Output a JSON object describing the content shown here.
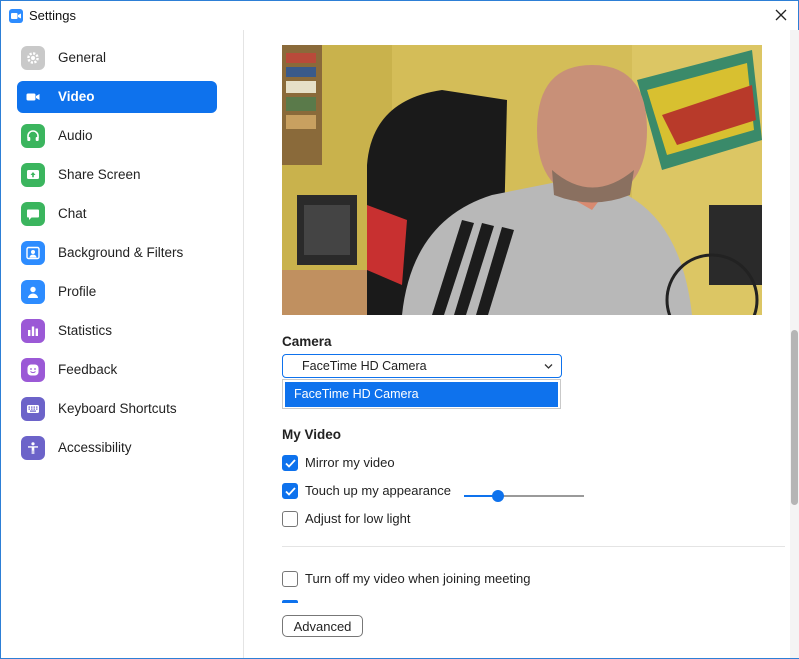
{
  "window": {
    "title": "Settings",
    "app_icon": "zoom-camera-icon",
    "close_icon": "close-icon"
  },
  "sidebar": {
    "items": [
      {
        "label": "General",
        "icon": "gear-icon",
        "color": "#c9c9c9",
        "active": false
      },
      {
        "label": "Video",
        "icon": "video-camera-icon",
        "color": "#0e72ed",
        "active": true
      },
      {
        "label": "Audio",
        "icon": "headphones-icon",
        "color": "#3bb55e",
        "active": false
      },
      {
        "label": "Share Screen",
        "icon": "share-screen-icon",
        "color": "#3bb55e",
        "active": false
      },
      {
        "label": "Chat",
        "icon": "chat-bubble-icon",
        "color": "#3bb55e",
        "active": false
      },
      {
        "label": "Background & Filters",
        "icon": "background-person-icon",
        "color": "#2d8cff",
        "active": false
      },
      {
        "label": "Profile",
        "icon": "profile-icon",
        "color": "#2d8cff",
        "active": false
      },
      {
        "label": "Statistics",
        "icon": "bar-chart-icon",
        "color": "#9b59d6",
        "active": false
      },
      {
        "label": "Feedback",
        "icon": "smiley-icon",
        "color": "#9b59d6",
        "active": false
      },
      {
        "label": "Keyboard Shortcuts",
        "icon": "keyboard-icon",
        "color": "#6c63c9",
        "active": false
      },
      {
        "label": "Accessibility",
        "icon": "accessibility-person-icon",
        "color": "#6c63c9",
        "active": false
      }
    ]
  },
  "camera": {
    "heading": "Camera",
    "selected": "FaceTime HD Camera",
    "options": [
      "FaceTime HD Camera"
    ],
    "dropdown_open": true
  },
  "my_video": {
    "heading": "My Video",
    "mirror": {
      "label": "Mirror my video",
      "checked": true
    },
    "touch_up": {
      "label": "Touch up my appearance",
      "checked": true,
      "level": 0.28
    },
    "low_light": {
      "label": "Adjust for low light",
      "checked": false
    }
  },
  "meeting": {
    "turn_off_video": {
      "label": "Turn off my video when joining meeting",
      "checked": false
    }
  },
  "advanced_button": "Advanced",
  "scroll": {
    "position": 0.5
  },
  "colors": {
    "accent": "#0e72ed",
    "window_border": "#2d7fd6"
  }
}
